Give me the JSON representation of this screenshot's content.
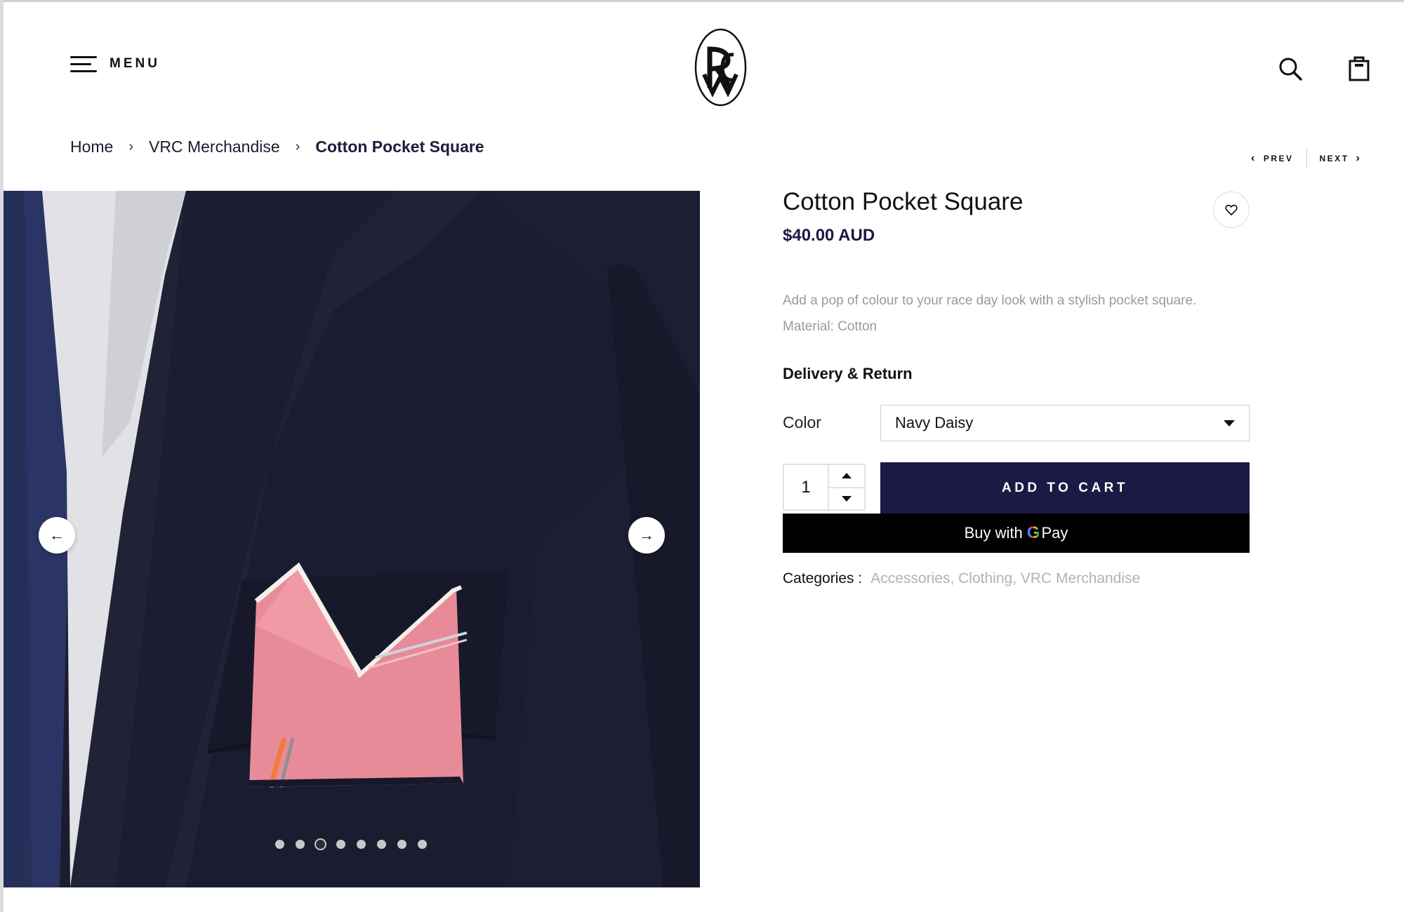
{
  "header": {
    "menu_label": "MENU",
    "icons": [
      "hamburger-icon",
      "vrc-monogram-logo",
      "search-icon",
      "shopping-bag-icon"
    ]
  },
  "breadcrumb": {
    "items": [
      "Home",
      "VRC Merchandise"
    ],
    "current": "Cotton Pocket Square",
    "separator": "›"
  },
  "pager": {
    "prev": "PREV",
    "next": "NEXT"
  },
  "gallery": {
    "slide_count": 8,
    "active_slide": 3,
    "icons": [
      "arrow-left-icon",
      "arrow-right-icon"
    ]
  },
  "product": {
    "title": "Cotton Pocket Square",
    "price": "$40.00 AUD",
    "description": "Add a pop of colour to your race day look with a stylish pocket square.",
    "material": "Material: Cotton",
    "delivery_label": "Delivery & Return",
    "color_label": "Color",
    "color_value": "Navy Daisy",
    "quantity": "1",
    "add_to_cart": "ADD TO CART",
    "gpay_prefix": "Buy with",
    "gpay_g": "G",
    "gpay_suffix": "Pay",
    "categories_label": "Categories :",
    "categories": [
      "Accessories,",
      "Clothing,",
      "VRC Merchandise"
    ]
  },
  "colors": {
    "brand_navy": "#1c1945",
    "price": "#1a1843",
    "muted_text": "#9a9a9a",
    "jacket": "#1a1c2f",
    "pocket_square": "#e88b98"
  }
}
